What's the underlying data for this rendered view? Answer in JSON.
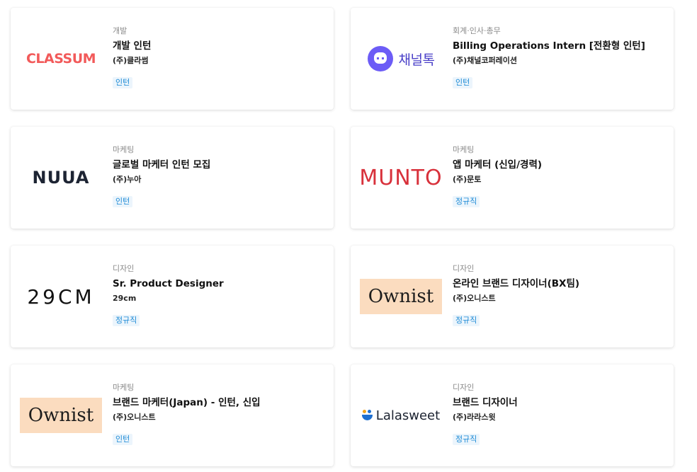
{
  "cards": [
    {
      "logo_text": "CLASSUM",
      "logo_icon": "classum-logo",
      "category": "개발",
      "title": "개발 인턴",
      "company": "(주)클라썸",
      "tag": "인턴"
    },
    {
      "logo_text": "채널톡",
      "logo_icon": "channeltalk-logo",
      "category": "회계·인사·총무",
      "title": "Billing Operations Intern [전환형 인턴]",
      "company": "(주)채널코퍼레이션",
      "tag": "인턴"
    },
    {
      "logo_text": "NUUA",
      "logo_icon": "nuua-logo",
      "category": "마케팅",
      "title": "글로벌 마케터 인턴 모집",
      "company": "(주)누아",
      "tag": "인턴"
    },
    {
      "logo_text": "MUNTO",
      "logo_icon": "munto-logo",
      "category": "마케팅",
      "title": "앱 마케터 (신입/경력)",
      "company": "(주)문토",
      "tag": "정규직"
    },
    {
      "logo_text": "29CM",
      "logo_icon": "29cm-logo",
      "category": "디자인",
      "title": "Sr. Product Designer",
      "company": "29cm",
      "tag": "정규직"
    },
    {
      "logo_text": "Ownist",
      "logo_icon": "ownist-logo",
      "category": "디자인",
      "title": "온라인 브랜드 디자이너(BX팀)",
      "company": "(주)오니스트",
      "tag": "정규직"
    },
    {
      "logo_text": "Ownist",
      "logo_icon": "ownist-logo",
      "category": "마케팅",
      "title": "브랜드 마케터(Japan) - 인턴, 신입",
      "company": "(주)오니스트",
      "tag": "인턴"
    },
    {
      "logo_text": "Lalasweet",
      "logo_icon": "lalasweet-logo",
      "category": "디자인",
      "title": "브랜드 디자이너",
      "company": "(주)라라스윗",
      "tag": "정규직"
    }
  ],
  "colors": {
    "tag_text": "#1e8bd6",
    "tag_bg": "#ecf5fc",
    "classum": "#f25a5a",
    "channeltalk": "#6c5cf6",
    "munto": "#d8313b",
    "ownist_bg": "#fbdcbf"
  }
}
